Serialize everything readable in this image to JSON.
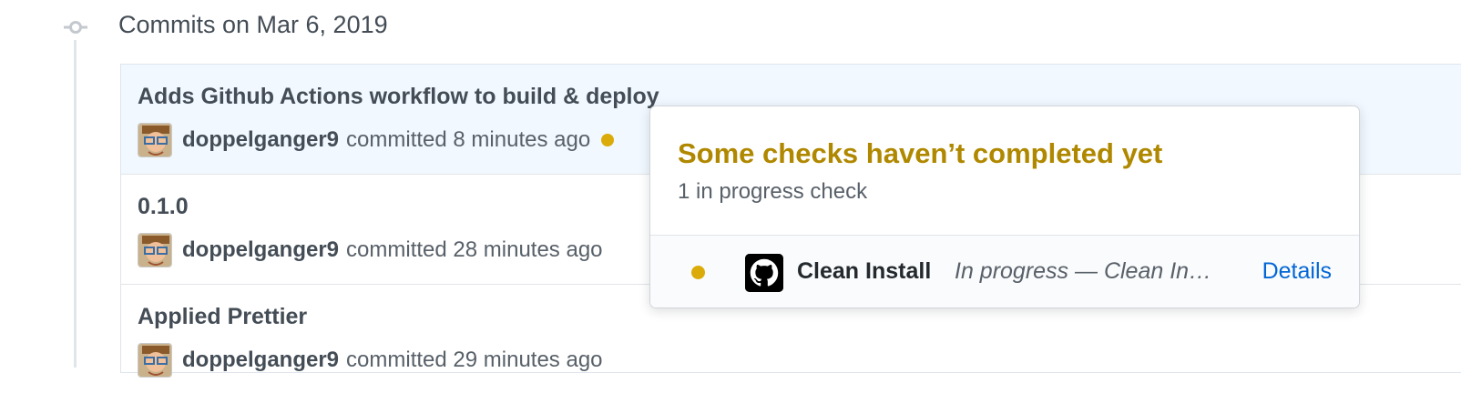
{
  "timeline": {
    "group_title": "Commits on Mar 6, 2019"
  },
  "commits": [
    {
      "title": "Adds Github Actions workflow to build & deploy",
      "author": "doppelganger9",
      "action": "committed",
      "time": "8 minutes ago",
      "status": "pending"
    },
    {
      "title": "0.1.0",
      "author": "doppelganger9",
      "action": "committed",
      "time": "28 minutes ago"
    },
    {
      "title": "Applied Prettier",
      "author": "doppelganger9",
      "action": "committed",
      "time": "29 minutes ago"
    }
  ],
  "popover": {
    "title": "Some checks haven’t completed yet",
    "subtitle": "1 in progress check",
    "checks": [
      {
        "name": "Clean Install",
        "description": "In progress — Clean Install",
        "details_label": "Details",
        "icon": "github-icon"
      }
    ]
  },
  "colors": {
    "pending": "#dbab09",
    "title_pending": "#b08800",
    "link": "#0366d6",
    "selected_row": "#f1f8ff"
  }
}
